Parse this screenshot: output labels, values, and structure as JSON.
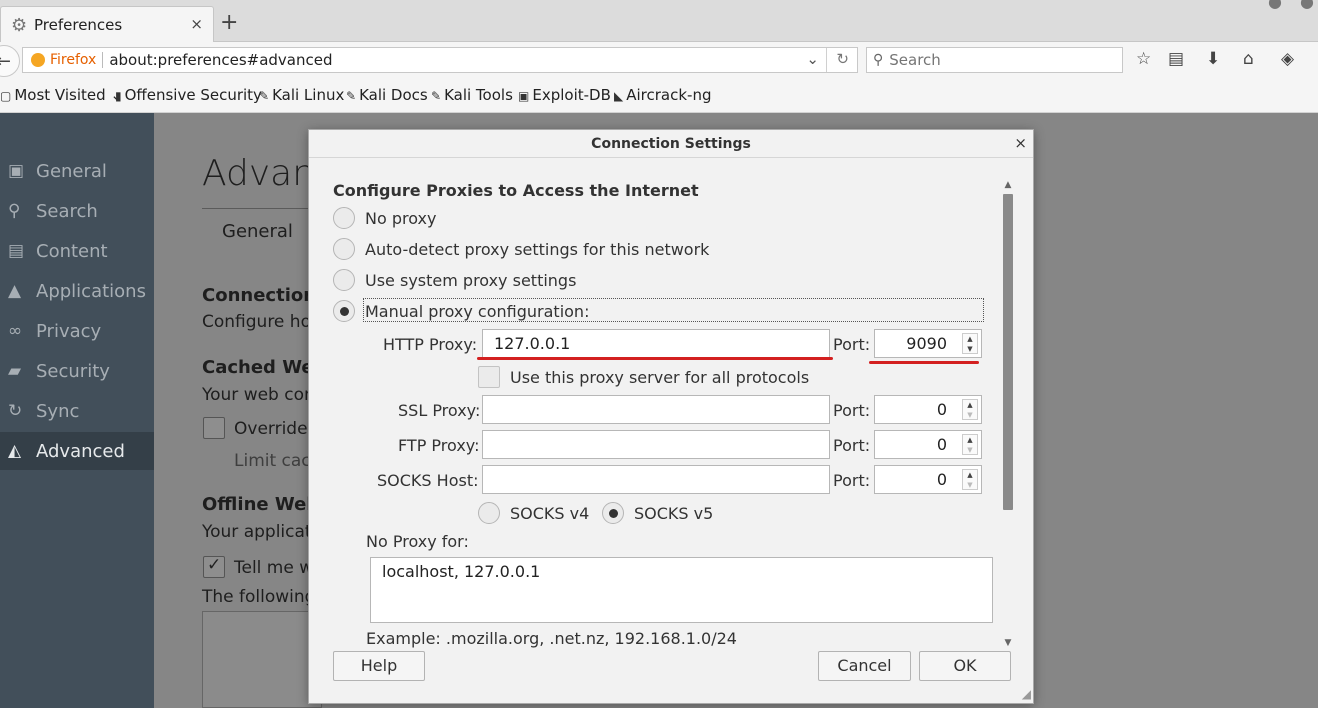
{
  "browser": {
    "tab_title": "Preferences",
    "tab_close": "×",
    "new_tab": "+",
    "identity_label": "Firefox",
    "url": "about:preferences#advanced",
    "search_placeholder": "Search",
    "bookmarks": [
      "Most Visited",
      "Offensive Security",
      "Kali Linux",
      "Kali Docs",
      "Kali Tools",
      "Exploit-DB",
      "Aircrack-ng"
    ]
  },
  "sidebar": {
    "items": [
      {
        "label": "General",
        "icon": "general-icon"
      },
      {
        "label": "Search",
        "icon": "search-icon"
      },
      {
        "label": "Content",
        "icon": "content-icon"
      },
      {
        "label": "Applications",
        "icon": "applications-icon"
      },
      {
        "label": "Privacy",
        "icon": "privacy-mask-icon"
      },
      {
        "label": "Security",
        "icon": "lock-icon"
      },
      {
        "label": "Sync",
        "icon": "sync-icon"
      },
      {
        "label": "Advanced",
        "icon": "advanced-icon"
      }
    ],
    "active": "Advanced"
  },
  "page": {
    "title": "Advanc",
    "tab_general": "General",
    "connection_head": "Connection",
    "connection_text": "Configure hov",
    "cached_head": "Cached Web",
    "cached_text": "Your web con",
    "override_label": "Override",
    "limit_label": "Limit cach",
    "offline_head": "Offline Web",
    "offline_text": "Your applicat",
    "tellme_label": "Tell me w",
    "following_text": "The following"
  },
  "dialog": {
    "title": "Connection Settings",
    "close": "×",
    "heading": "Configure Proxies to Access the Internet",
    "options": {
      "no_proxy": "No proxy",
      "auto_detect": "Auto-detect proxy settings for this network",
      "system": "Use system proxy settings",
      "manual": "Manual proxy configuration:"
    },
    "selected_option": "manual",
    "http_label": "HTTP Proxy:",
    "http_value": "127.0.0.1",
    "http_port": "9090",
    "use_for_all": "Use this proxy server for all protocols",
    "ssl_label": "SSL Proxy:",
    "ssl_value": "",
    "ssl_port": "0",
    "ftp_label": "FTP Proxy:",
    "ftp_value": "",
    "ftp_port": "0",
    "socks_label": "SOCKS Host:",
    "socks_value": "",
    "socks_port": "0",
    "port_label": "Port:",
    "socks_v4": "SOCKS v4",
    "socks_v5": "SOCKS v5",
    "socks_selected": "v5",
    "no_proxy_for_label": "No Proxy for:",
    "no_proxy_for_value": "localhost, 127.0.0.1",
    "example": "Example: .mozilla.org, .net.nz, 192.168.1.0/24",
    "help": "Help",
    "cancel": "Cancel",
    "ok": "OK",
    "annotation_color": "#d32020"
  }
}
